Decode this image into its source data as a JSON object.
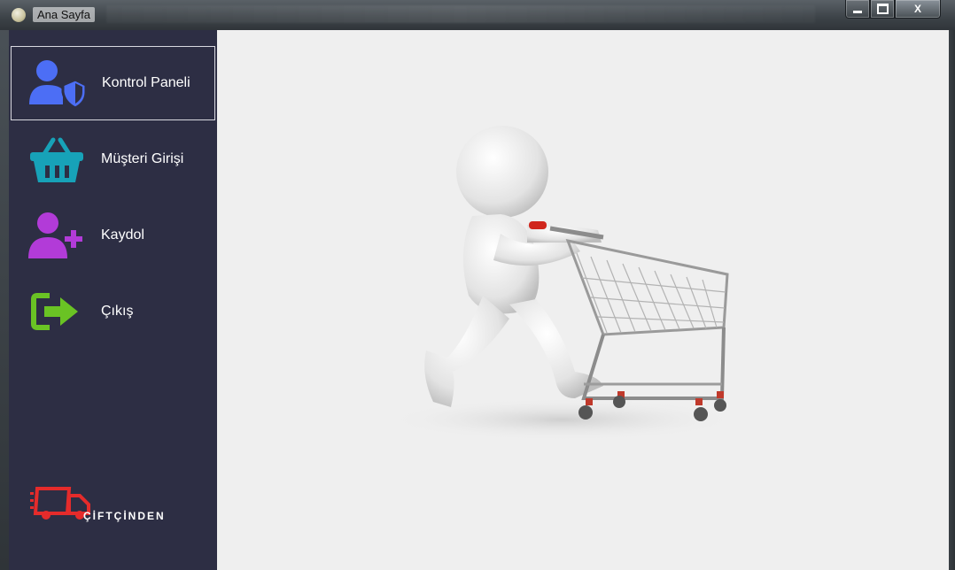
{
  "window": {
    "title": "Ana Sayfa",
    "controls": {
      "minimize": "minimize-icon",
      "maximize": "maximize-icon",
      "close": "X"
    }
  },
  "sidebar": {
    "items": [
      {
        "label": "Kontrol Paneli",
        "icon": "user-shield-icon",
        "icon_color": "#4c6ef5",
        "active": true
      },
      {
        "label": "Müşteri Girişi",
        "icon": "shopping-basket-icon",
        "icon_color": "#17a2b8",
        "active": false
      },
      {
        "label": "Kaydol",
        "icon": "user-plus-icon",
        "icon_color": "#b23bd8",
        "active": false
      },
      {
        "label": "Çıkış",
        "icon": "sign-out-icon",
        "icon_color": "#6ac324",
        "active": false
      }
    ],
    "logo": {
      "text": "ÇİFTÇİNDEN",
      "color": "#e52b2b"
    }
  },
  "content": {
    "image": "shopping-cart-figure"
  },
  "colors": {
    "sidebar_bg": "#2d2e44",
    "content_bg": "#efefef"
  }
}
